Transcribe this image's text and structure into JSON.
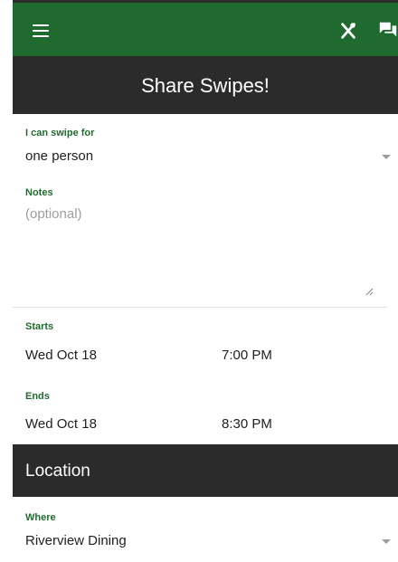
{
  "header": {
    "menu_icon": "hamburger-menu-icon",
    "utensils_icon": "utensils-icon",
    "chat_icon": "chat-icon",
    "brand_color": "#1f6b2f"
  },
  "page": {
    "title": "Share Swipes!"
  },
  "form": {
    "swipe_for": {
      "label": "I can swipe for",
      "value": "one person"
    },
    "notes": {
      "label": "Notes",
      "placeholder": "(optional)",
      "value": ""
    },
    "starts": {
      "label": "Starts",
      "date": "Wed Oct 18",
      "time": "7:00 PM"
    },
    "ends": {
      "label": "Ends",
      "date": "Wed Oct 18",
      "time": "8:30 PM"
    }
  },
  "location": {
    "heading": "Location",
    "where": {
      "label": "Where",
      "value": "Riverview Dining"
    }
  }
}
